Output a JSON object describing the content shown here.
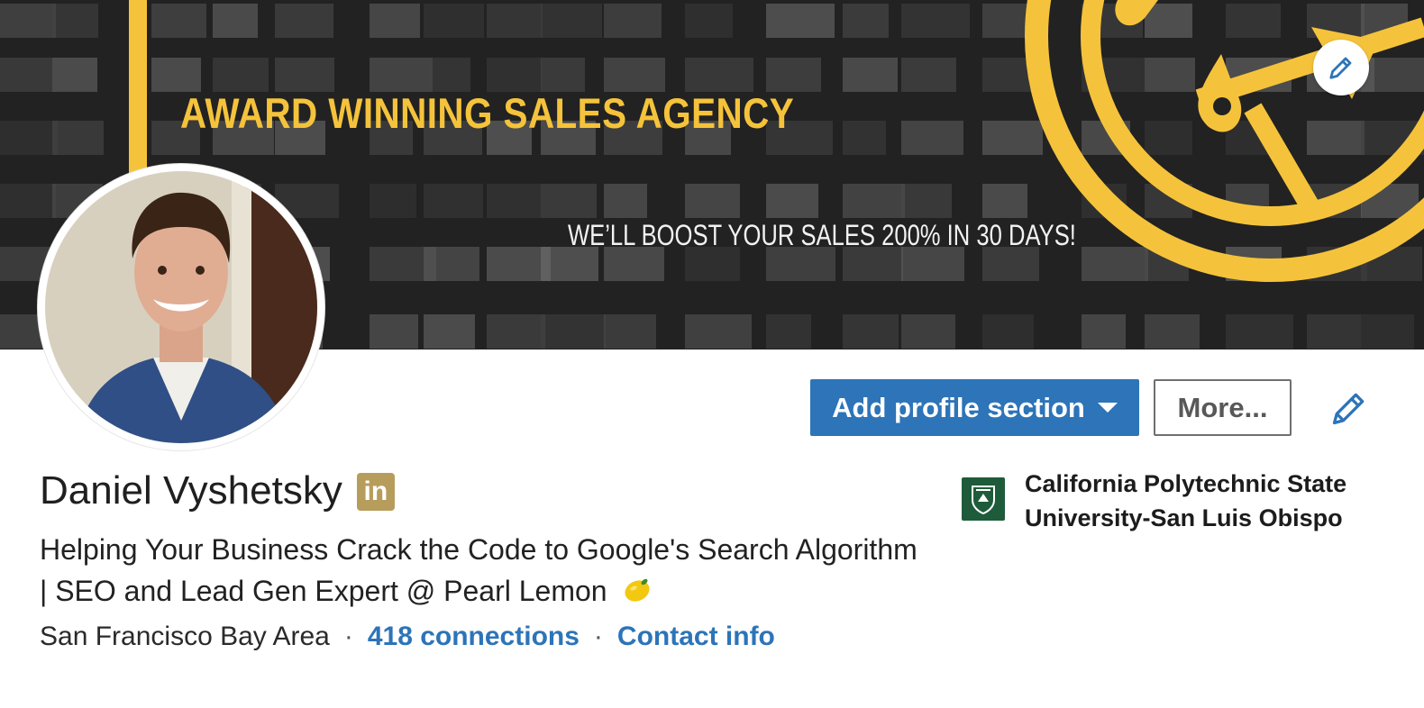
{
  "banner": {
    "headline": "AWARD WINNING SALES AGENCY",
    "subline": "WE’LL BOOST YOUR SALES 200% IN 30 DAYS!",
    "accent_color": "#f5c33b"
  },
  "profile": {
    "name": "Daniel Vyshetsky",
    "badge_text": "in",
    "headline": "Helping Your Business Crack the Code to Google's Search Algorithm | SEO and Lead Gen Expert @ Pearl Lemon",
    "location": "San Francisco Bay Area",
    "connections": "418 connections",
    "contact_info": "Contact info",
    "separator": "·"
  },
  "actions": {
    "add_section": "Add profile section",
    "more": "More..."
  },
  "education": {
    "school": "California Polytechnic State University-San Luis Obispo"
  },
  "icons": {
    "banner_edit": "pencil-icon",
    "intro_edit": "pencil-icon",
    "linkedin_badge": "linkedin-icon",
    "lemon": "lemon-emoji-icon",
    "school_logo": "school-crest-icon"
  },
  "colors": {
    "primary_blue": "#2d74b8",
    "badge_gold": "#b79d5b",
    "school_green": "#1e5b3a"
  }
}
